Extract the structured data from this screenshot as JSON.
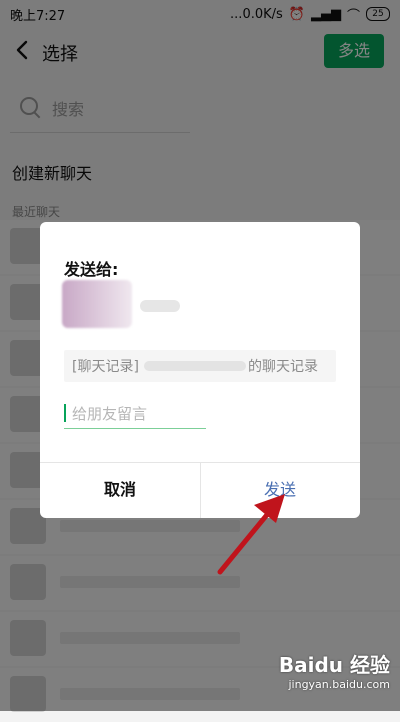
{
  "statusbar": {
    "time": "晚上7:27",
    "speed": "...0.0K/s",
    "battery": "25"
  },
  "topbar": {
    "title": "选择",
    "multi_select": "多选"
  },
  "search": {
    "placeholder": "搜索"
  },
  "labels": {
    "create_new_chat": "创建新聊天",
    "recent_chats": "最近聊天"
  },
  "dialog": {
    "title": "发送给:",
    "card_text_left": "[聊天记录]",
    "card_text_right": "的聊天记录",
    "message_placeholder": "给朋友留言",
    "cancel": "取消",
    "send": "发送"
  },
  "watermark": {
    "brand": "Baidu 经验",
    "url": "jingyan.baidu.com"
  },
  "colors": {
    "accent_green": "#07a35a",
    "send_blue": "#4a6fb2",
    "annotation_red": "#c0141c"
  }
}
